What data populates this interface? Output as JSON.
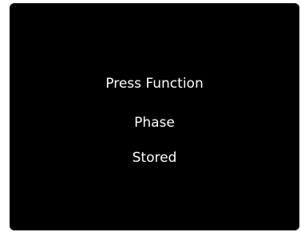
{
  "display": {
    "background_color": "#000000",
    "text_color": "#ffffff",
    "lines": [
      "Press Function",
      "Phase",
      "Stored"
    ]
  }
}
